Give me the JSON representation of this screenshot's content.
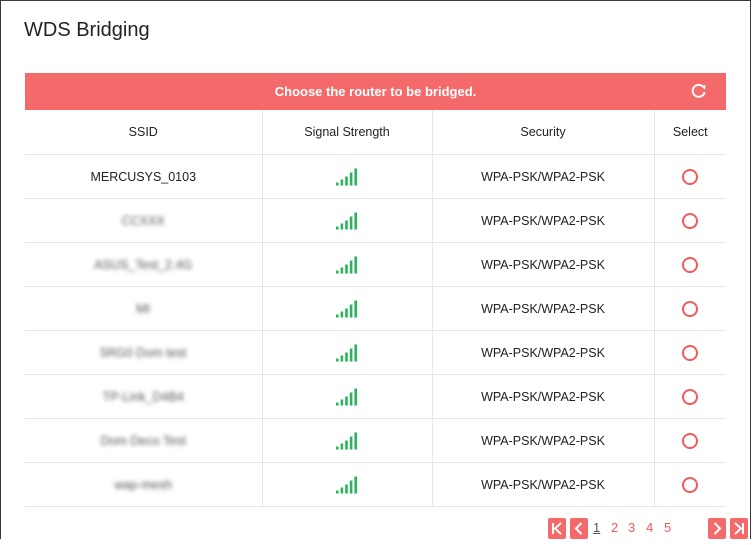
{
  "title": "WDS Bridging",
  "banner": {
    "text": "Choose the router to be bridged.",
    "refresh_icon": "refresh-icon"
  },
  "columns": [
    "SSID",
    "Signal Strength",
    "Security",
    "Select"
  ],
  "rows": [
    {
      "ssid": "MERCUSYS_0103",
      "security": "WPA-PSK/WPA2-PSK",
      "signal": 5
    },
    {
      "ssid": "CCXXX",
      "security": "WPA-PSK/WPA2-PSK",
      "signal": 5
    },
    {
      "ssid": "ASUS_Test_2.4G",
      "security": "WPA-PSK/WPA2-PSK",
      "signal": 5
    },
    {
      "ssid": "MI",
      "security": "WPA-PSK/WPA2-PSK",
      "signal": 5
    },
    {
      "ssid": "5RG0 Dom test",
      "security": "WPA-PSK/WPA2-PSK",
      "signal": 5
    },
    {
      "ssid": "TP-Link_D4B4",
      "security": "WPA-PSK/WPA2-PSK",
      "signal": 5
    },
    {
      "ssid": "Dom Deco Test",
      "security": "WPA-PSK/WPA2-PSK",
      "signal": 5
    },
    {
      "ssid": "wap-mesh",
      "security": "WPA-PSK/WPA2-PSK",
      "signal": 5
    }
  ],
  "pagination": {
    "pages": [
      "1",
      "2",
      "3",
      "4",
      "5"
    ],
    "current": "1"
  },
  "colors": {
    "accent": "#f46a6a",
    "signal": "#2db35d"
  }
}
